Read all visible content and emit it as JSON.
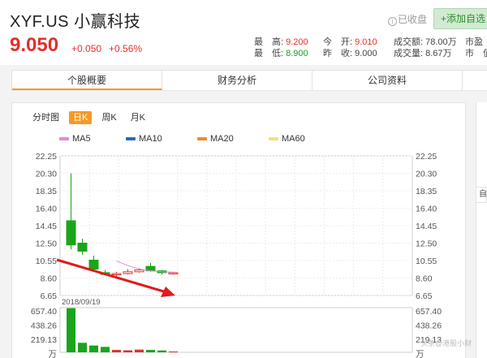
{
  "header": {
    "stock_name": "XYF.US 小赢科技",
    "price": "9.050",
    "change": "+0.050",
    "change_pct": "+0.56%",
    "watch_label": "已收盘",
    "add_watch_label": "+添加自选"
  },
  "quote": {
    "high_label": "最　高:",
    "high": "9.200",
    "low_label": "最　低:",
    "low": "8.900",
    "open_label": "今　开:",
    "open": "9.010",
    "prev_label": "昨　收:",
    "prev": "9.000",
    "turnover_label": "成交额:",
    "turnover": "78.00万",
    "volume_label": "成交量:",
    "volume": "8.67万",
    "pe_label": "市盈",
    "mkt_label": "市　值"
  },
  "tabs": [
    "个股概要",
    "财务分析",
    "公司资料"
  ],
  "period_tabs": [
    "分时图",
    "日K",
    "周K",
    "月K"
  ],
  "legend": [
    {
      "name": "MA5",
      "color": "#e08bd6"
    },
    {
      "name": "MA10",
      "color": "#2a6bb6"
    },
    {
      "name": "MA20",
      "color": "#f08a24"
    },
    {
      "name": "MA60",
      "color": "#f3e07a"
    }
  ],
  "chart_data": {
    "type": "candlestick",
    "price_ticks": [
      "22.25",
      "20.30",
      "18.35",
      "16.40",
      "14.45",
      "12.50",
      "10.55",
      "8.60",
      "6.65"
    ],
    "ylim": [
      6.65,
      22.25
    ],
    "date_label": "2018/09/19",
    "volume_ticks": [
      "657.40",
      "438.26",
      "219.13",
      "万"
    ],
    "volume_max": 657.4,
    "candles": [
      {
        "open": 15.0,
        "close": 12.3,
        "high": 20.3,
        "low": 11.8,
        "vol": 650
      },
      {
        "open": 12.5,
        "close": 11.6,
        "high": 13.0,
        "low": 11.2,
        "vol": 140
      },
      {
        "open": 10.6,
        "close": 9.6,
        "high": 11.1,
        "low": 9.4,
        "vol": 100
      },
      {
        "open": 9.2,
        "close": 9.0,
        "high": 9.5,
        "low": 8.9,
        "vol": 80
      },
      {
        "open": 9.0,
        "close": 9.1,
        "high": 9.3,
        "low": 8.8,
        "vol": 35
      },
      {
        "open": 9.1,
        "close": 9.3,
        "high": 9.6,
        "low": 9.0,
        "vol": 30
      },
      {
        "open": 9.3,
        "close": 9.5,
        "high": 9.7,
        "low": 9.2,
        "vol": 40
      },
      {
        "open": 9.9,
        "close": 9.4,
        "high": 10.3,
        "low": 9.3,
        "vol": 35
      },
      {
        "open": 9.4,
        "close": 9.2,
        "high": 9.5,
        "low": 9.0,
        "vol": 28
      },
      {
        "open": 9.1,
        "close": 9.2,
        "high": 9.3,
        "low": 9.0,
        "vol": 12
      }
    ],
    "ma5": [
      null,
      null,
      null,
      null,
      10.5,
      10.0,
      9.6,
      9.4,
      9.3,
      9.25
    ],
    "annotation": "red down arrow"
  },
  "watermark": "头条@港股小财"
}
